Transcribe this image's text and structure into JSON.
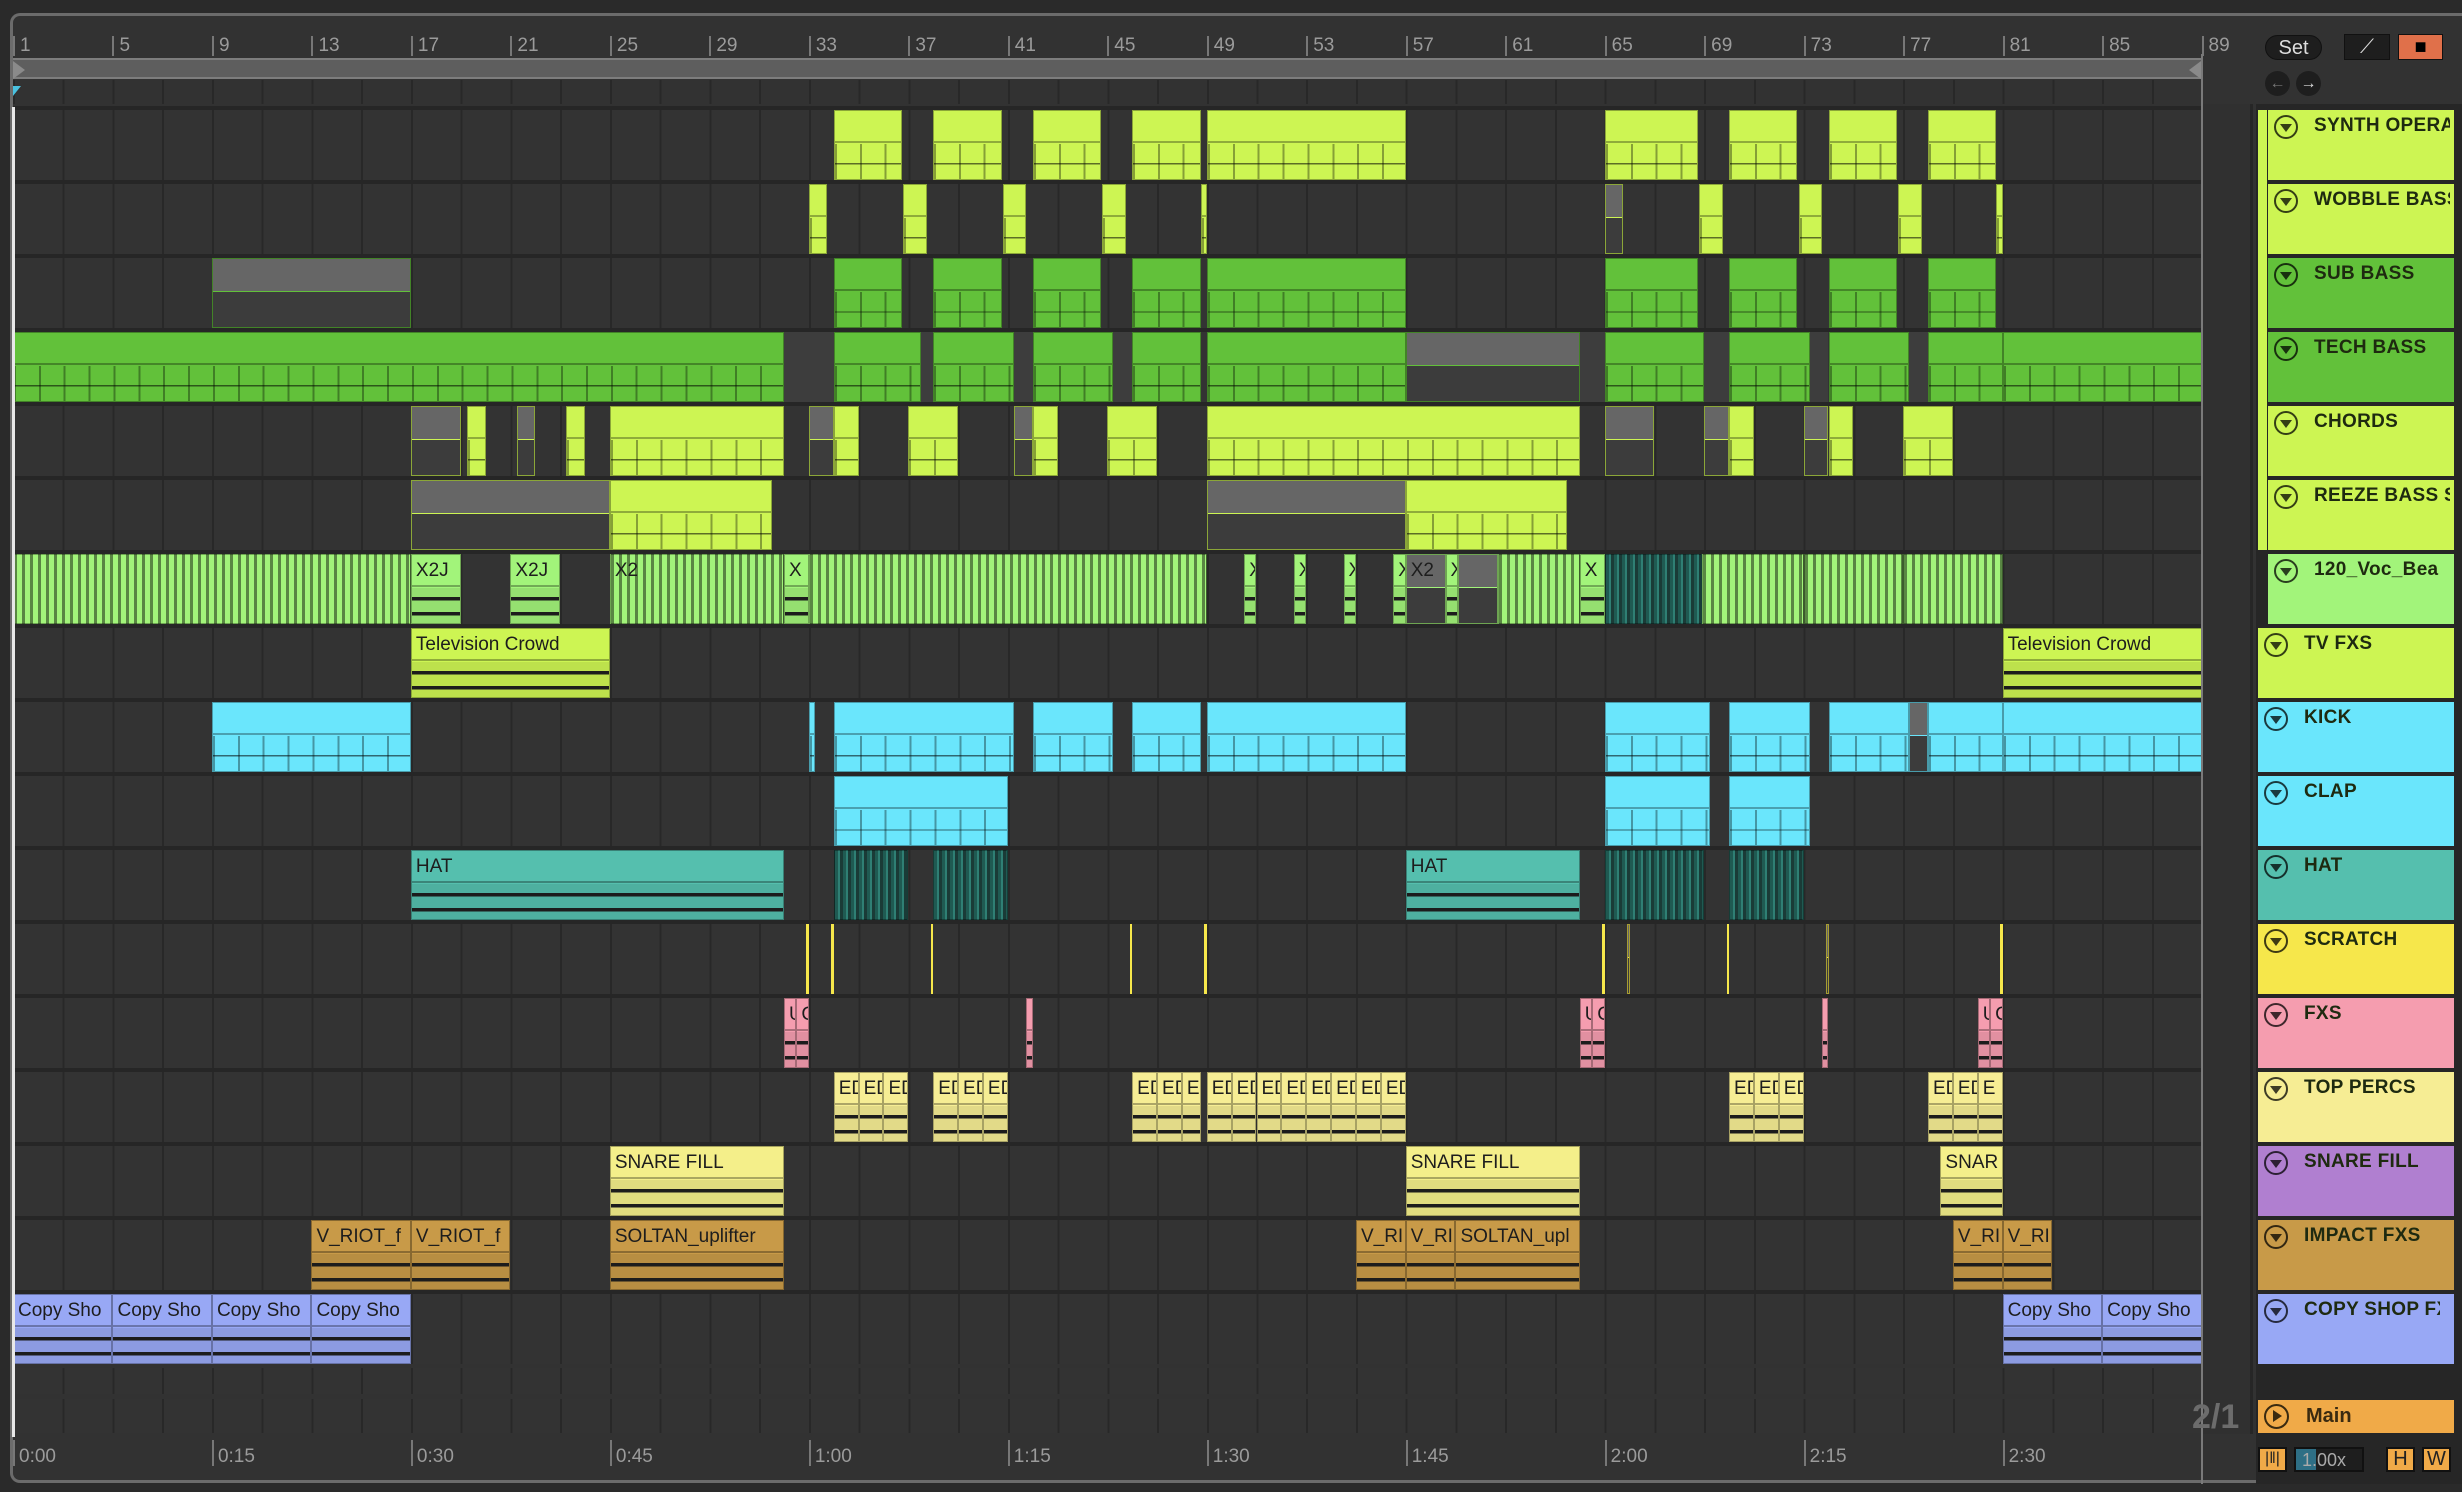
{
  "ruler": {
    "bars": [
      "1",
      "5",
      "9",
      "13",
      "17",
      "21",
      "25",
      "29",
      "33",
      "37",
      "41",
      "45",
      "49",
      "53",
      "57",
      "61",
      "65",
      "69",
      "73",
      "77",
      "81",
      "85",
      "89"
    ],
    "times": [
      "0:00",
      "0:15",
      "0:30",
      "0:45",
      "1:00",
      "1:15",
      "1:30",
      "1:45",
      "2:00",
      "2:15",
      "2:30"
    ]
  },
  "controls": {
    "set_label": "Set",
    "signature": "2/1",
    "zoom_value": "1.00x",
    "h_label": "H",
    "w_label": "W",
    "main_label": "Main",
    "main_color": "#f0aa48",
    "lock_color": "#e0704a"
  },
  "tracks": [
    {
      "name": "SYNTH OPERA",
      "color": "#cdf553",
      "group": true,
      "clips": [
        {
          "s": 34,
          "e": 36.75,
          "k": "midi"
        },
        {
          "s": 38,
          "e": 40.75,
          "k": "midi"
        },
        {
          "s": 42,
          "e": 44.75,
          "k": "midi"
        },
        {
          "s": 46,
          "e": 48.75,
          "k": "midi"
        },
        {
          "s": 49,
          "e": 57,
          "k": "midi"
        },
        {
          "s": 65,
          "e": 68.75,
          "k": "midi"
        },
        {
          "s": 70,
          "e": 72.75,
          "k": "midi"
        },
        {
          "s": 74,
          "e": 76.75,
          "k": "midi"
        },
        {
          "s": 78,
          "e": 80.75,
          "k": "midi"
        }
      ]
    },
    {
      "name": "WOBBLE BASS",
      "color": "#cdf553",
      "group": true,
      "clips": [
        {
          "s": 33,
          "e": 33.75,
          "k": "midi"
        },
        {
          "s": 36.8,
          "e": 37.75,
          "k": "midi"
        },
        {
          "s": 40.8,
          "e": 41.75,
          "k": "midi"
        },
        {
          "s": 44.8,
          "e": 45.75,
          "k": "midi"
        },
        {
          "s": 48.75,
          "e": 49,
          "k": "midi"
        },
        {
          "s": 65,
          "e": 65.75,
          "k": "muted"
        },
        {
          "s": 68.8,
          "e": 69.75,
          "k": "midi"
        },
        {
          "s": 72.8,
          "e": 73.75,
          "k": "midi"
        },
        {
          "s": 76.8,
          "e": 77.75,
          "k": "midi"
        },
        {
          "s": 80.75,
          "e": 81,
          "k": "midi"
        }
      ]
    },
    {
      "name": "SUB BASS",
      "color": "#62c13a",
      "group": true,
      "clips": [
        {
          "s": 9,
          "e": 17,
          "k": "muted"
        },
        {
          "s": 34,
          "e": 36.75,
          "k": "midi"
        },
        {
          "s": 38,
          "e": 40.75,
          "k": "midi"
        },
        {
          "s": 42,
          "e": 44.75,
          "k": "midi"
        },
        {
          "s": 46,
          "e": 48.75,
          "k": "midi"
        },
        {
          "s": 49,
          "e": 57,
          "k": "midi"
        },
        {
          "s": 65,
          "e": 68.75,
          "k": "midi"
        },
        {
          "s": 70,
          "e": 72.75,
          "k": "midi"
        },
        {
          "s": 74,
          "e": 76.75,
          "k": "midi"
        },
        {
          "s": 78,
          "e": 80.75,
          "k": "midi"
        }
      ]
    },
    {
      "name": "TECH BASS",
      "color": "#62c13a",
      "group": true,
      "clips": [
        {
          "s": 1,
          "e": 32,
          "k": "midi"
        },
        {
          "s": 32,
          "e": 34,
          "k": "gap"
        },
        {
          "s": 34,
          "e": 37.5,
          "k": "midi"
        },
        {
          "s": 37.5,
          "e": 38,
          "k": "gap"
        },
        {
          "s": 38,
          "e": 41.25,
          "k": "midi"
        },
        {
          "s": 41.25,
          "e": 42,
          "k": "gap"
        },
        {
          "s": 42,
          "e": 45.25,
          "k": "midi"
        },
        {
          "s": 45.25,
          "e": 46,
          "k": "gap"
        },
        {
          "s": 46,
          "e": 48.75,
          "k": "midi"
        },
        {
          "s": 49,
          "e": 57,
          "k": "midi"
        },
        {
          "s": 57,
          "e": 64,
          "k": "muted"
        },
        {
          "s": 64,
          "e": 65,
          "k": "gap"
        },
        {
          "s": 65,
          "e": 69,
          "k": "midi"
        },
        {
          "s": 69,
          "e": 70,
          "k": "gap"
        },
        {
          "s": 70,
          "e": 73.25,
          "k": "midi"
        },
        {
          "s": 73.25,
          "e": 74,
          "k": "gap"
        },
        {
          "s": 74,
          "e": 77.25,
          "k": "midi"
        },
        {
          "s": 77.25,
          "e": 78,
          "k": "gap"
        },
        {
          "s": 78,
          "e": 81,
          "k": "midi"
        },
        {
          "s": 81,
          "e": 89,
          "k": "midi"
        }
      ]
    },
    {
      "name": "CHORDS",
      "color": "#cdf553",
      "group": true,
      "clips": [
        {
          "s": 17,
          "e": 19,
          "k": "muted"
        },
        {
          "s": 19.25,
          "e": 20,
          "k": "midi"
        },
        {
          "s": 21.25,
          "e": 22,
          "k": "muted"
        },
        {
          "s": 23.25,
          "e": 24,
          "k": "midi"
        },
        {
          "s": 25,
          "e": 32,
          "k": "midi"
        },
        {
          "s": 33,
          "e": 34,
          "k": "muted"
        },
        {
          "s": 34,
          "e": 35,
          "k": "midi"
        },
        {
          "s": 37,
          "e": 39,
          "k": "midi"
        },
        {
          "s": 41.25,
          "e": 42,
          "k": "muted"
        },
        {
          "s": 42,
          "e": 43,
          "k": "midi"
        },
        {
          "s": 45,
          "e": 47,
          "k": "midi"
        },
        {
          "s": 49,
          "e": 64,
          "k": "midi"
        },
        {
          "s": 65,
          "e": 67,
          "k": "muted"
        },
        {
          "s": 69,
          "e": 70,
          "k": "muted"
        },
        {
          "s": 70,
          "e": 71,
          "k": "midi"
        },
        {
          "s": 73,
          "e": 74,
          "k": "muted"
        },
        {
          "s": 74,
          "e": 75,
          "k": "midi"
        },
        {
          "s": 77,
          "e": 79,
          "k": "midi"
        }
      ]
    },
    {
      "name": "REEZE BASS S",
      "color": "#cdf553",
      "group": true,
      "clips": [
        {
          "s": 17,
          "e": 25,
          "k": "muted"
        },
        {
          "s": 25,
          "e": 31.5,
          "k": "midi"
        },
        {
          "s": 49,
          "e": 57,
          "k": "muted"
        },
        {
          "s": 57,
          "e": 63.5,
          "k": "midi"
        }
      ]
    },
    {
      "name": "120_Voc_Bea",
      "color": "#a2f47a",
      "group": true,
      "clips": [
        {
          "s": 1,
          "e": 17,
          "k": "dense"
        },
        {
          "s": 17,
          "e": 19,
          "k": "audio",
          "n": "X2J"
        },
        {
          "s": 21,
          "e": 23,
          "k": "audio",
          "n": "X2J"
        },
        {
          "s": 25,
          "e": 32,
          "k": "dense",
          "n": "X2"
        },
        {
          "s": 32,
          "e": 33,
          "k": "audio",
          "n": "X"
        },
        {
          "s": 33,
          "e": 49,
          "k": "dense"
        },
        {
          "s": 50.5,
          "e": 51,
          "k": "audio",
          "n": "X"
        },
        {
          "s": 52.5,
          "e": 53,
          "k": "audio",
          "n": "X"
        },
        {
          "s": 54.5,
          "e": 55,
          "k": "audio",
          "n": "X"
        },
        {
          "s": 56.5,
          "e": 57,
          "k": "audio",
          "n": "X"
        },
        {
          "s": 57,
          "e": 58.6,
          "k": "muted",
          "n": "X2"
        },
        {
          "s": 58.6,
          "e": 59.1,
          "k": "audio",
          "n": "X"
        },
        {
          "s": 59.1,
          "e": 60.7,
          "k": "muted"
        },
        {
          "s": 60.7,
          "e": 64,
          "k": "dense"
        },
        {
          "s": 64,
          "e": 65,
          "k": "audio",
          "n": "X"
        },
        {
          "s": 65,
          "e": 68.9,
          "k": "darkdense"
        },
        {
          "s": 68.9,
          "e": 73,
          "k": "dense"
        },
        {
          "s": 73,
          "e": 77,
          "k": "dense"
        },
        {
          "s": 77,
          "e": 81,
          "k": "dense"
        }
      ]
    },
    {
      "name": "TV FXS",
      "color": "#cdf553",
      "group": false,
      "clips": [
        {
          "s": 17,
          "e": 25,
          "k": "audio",
          "n": "Television Crowd"
        },
        {
          "s": 81,
          "e": 89,
          "k": "audio",
          "n": "Television Crowd"
        }
      ]
    },
    {
      "name": "KICK",
      "color": "#6ae6fc",
      "group": false,
      "clips": [
        {
          "s": 9,
          "e": 17,
          "k": "midi"
        },
        {
          "s": 33,
          "e": 33.25,
          "k": "midi"
        },
        {
          "s": 34,
          "e": 41.25,
          "k": "midi"
        },
        {
          "s": 42,
          "e": 45.25,
          "k": "midi"
        },
        {
          "s": 46,
          "e": 48.75,
          "k": "midi"
        },
        {
          "s": 49,
          "e": 57,
          "k": "midi"
        },
        {
          "s": 65,
          "e": 69.25,
          "k": "midi"
        },
        {
          "s": 70,
          "e": 73.25,
          "k": "midi"
        },
        {
          "s": 74,
          "e": 77.25,
          "k": "midi"
        },
        {
          "s": 77.25,
          "e": 78,
          "k": "muted"
        },
        {
          "s": 78,
          "e": 81,
          "k": "midi"
        },
        {
          "s": 81,
          "e": 89,
          "k": "midi"
        }
      ]
    },
    {
      "name": "CLAP",
      "color": "#6ae6fc",
      "group": false,
      "clips": [
        {
          "s": 34,
          "e": 41,
          "k": "midi"
        },
        {
          "s": 65,
          "e": 69.25,
          "k": "midi"
        },
        {
          "s": 70,
          "e": 73.25,
          "k": "midi"
        }
      ]
    },
    {
      "name": "HAT",
      "color": "#55bfae",
      "group": false,
      "clips": [
        {
          "s": 17,
          "e": 32,
          "k": "audio",
          "n": "HAT"
        },
        {
          "s": 34,
          "e": 37,
          "k": "darkdense"
        },
        {
          "s": 38,
          "e": 41,
          "k": "darkdense"
        },
        {
          "s": 57,
          "e": 64,
          "k": "audio",
          "n": "HAT"
        },
        {
          "s": 65,
          "e": 69,
          "k": "darkdense"
        },
        {
          "s": 70,
          "e": 73,
          "k": "darkdense"
        }
      ]
    },
    {
      "name": "SCRATCH",
      "color": "#f6e74b",
      "group": false,
      "clips": [
        {
          "s": 32.9,
          "e": 33,
          "k": "thin"
        },
        {
          "s": 33.9,
          "e": 34,
          "k": "thin"
        },
        {
          "s": 37.9,
          "e": 38,
          "k": "thin"
        },
        {
          "s": 45.9,
          "e": 46,
          "k": "thin"
        },
        {
          "s": 48.9,
          "e": 49,
          "k": "thin"
        },
        {
          "s": 64.9,
          "e": 65,
          "k": "thin"
        },
        {
          "s": 65.9,
          "e": 66,
          "k": "muted"
        },
        {
          "s": 69.9,
          "e": 70,
          "k": "thin"
        },
        {
          "s": 73.9,
          "e": 74,
          "k": "muted"
        },
        {
          "s": 80.9,
          "e": 81,
          "k": "thin"
        }
      ]
    },
    {
      "name": "FXS",
      "color": "#f59daf",
      "group": false,
      "clips": [
        {
          "s": 32,
          "e": 32.5,
          "k": "audio",
          "n": "U"
        },
        {
          "s": 32.5,
          "e": 33,
          "k": "audio",
          "n": "C"
        },
        {
          "s": 41.75,
          "e": 42,
          "k": "audio"
        },
        {
          "s": 64,
          "e": 64.5,
          "k": "audio",
          "n": "U"
        },
        {
          "s": 64.5,
          "e": 65,
          "k": "audio",
          "n": "C"
        },
        {
          "s": 73.75,
          "e": 74,
          "k": "audio"
        },
        {
          "s": 80,
          "e": 80.5,
          "k": "audio",
          "n": "U"
        },
        {
          "s": 80.5,
          "e": 81,
          "k": "audio",
          "n": "C"
        }
      ]
    },
    {
      "name": "TOP PERCS",
      "color": "#f6ed94",
      "group": false,
      "clips": [
        {
          "s": 34,
          "e": 35,
          "k": "audio",
          "n": "ED"
        },
        {
          "s": 35,
          "e": 36,
          "k": "audio",
          "n": "ED"
        },
        {
          "s": 36,
          "e": 37,
          "k": "audio",
          "n": "ED"
        },
        {
          "s": 38,
          "e": 39,
          "k": "audio",
          "n": "ED"
        },
        {
          "s": 39,
          "e": 40,
          "k": "audio",
          "n": "ED"
        },
        {
          "s": 40,
          "e": 41,
          "k": "audio",
          "n": "ED"
        },
        {
          "s": 46,
          "e": 47,
          "k": "audio",
          "n": "ED"
        },
        {
          "s": 47,
          "e": 48,
          "k": "audio",
          "n": "ED"
        },
        {
          "s": 48,
          "e": 48.75,
          "k": "audio",
          "n": "ED"
        },
        {
          "s": 49,
          "e": 50,
          "k": "audio",
          "n": "ED"
        },
        {
          "s": 50,
          "e": 51,
          "k": "audio",
          "n": "ED"
        },
        {
          "s": 51,
          "e": 52,
          "k": "audio",
          "n": "ED"
        },
        {
          "s": 52,
          "e": 53,
          "k": "audio",
          "n": "ED"
        },
        {
          "s": 53,
          "e": 54,
          "k": "audio",
          "n": "ED"
        },
        {
          "s": 54,
          "e": 55,
          "k": "audio",
          "n": "ED"
        },
        {
          "s": 55,
          "e": 56,
          "k": "audio",
          "n": "ED"
        },
        {
          "s": 56,
          "e": 57,
          "k": "audio",
          "n": "ED"
        },
        {
          "s": 70,
          "e": 71,
          "k": "audio",
          "n": "ED"
        },
        {
          "s": 71,
          "e": 72,
          "k": "audio",
          "n": "ED"
        },
        {
          "s": 72,
          "e": 73,
          "k": "audio",
          "n": "ED"
        },
        {
          "s": 78,
          "e": 79,
          "k": "audio",
          "n": "ED"
        },
        {
          "s": 79,
          "e": 80,
          "k": "audio",
          "n": "ED"
        },
        {
          "s": 80,
          "e": 81,
          "k": "audio",
          "n": "E"
        }
      ]
    },
    {
      "name": "SNARE FILL",
      "color": "#b07fd0",
      "clipcolor": "#f4ef8a",
      "group": false,
      "clips": [
        {
          "s": 25,
          "e": 32,
          "k": "audio",
          "n": "SNARE FILL"
        },
        {
          "s": 57,
          "e": 64,
          "k": "audio",
          "n": "SNARE FILL"
        },
        {
          "s": 78.5,
          "e": 81,
          "k": "audio",
          "n": "SNAR"
        }
      ]
    },
    {
      "name": "IMPACT FXS",
      "color": "#c89a48",
      "group": false,
      "clips": [
        {
          "s": 13,
          "e": 17,
          "k": "audio",
          "n": "V_RIOT_f"
        },
        {
          "s": 17,
          "e": 21,
          "k": "audio",
          "n": "V_RIOT_f"
        },
        {
          "s": 25,
          "e": 32,
          "k": "audio",
          "n": "SOLTAN_uplifter"
        },
        {
          "s": 55,
          "e": 57,
          "k": "audio",
          "n": "V_RI"
        },
        {
          "s": 57,
          "e": 59,
          "k": "audio",
          "n": "V_RI"
        },
        {
          "s": 59,
          "e": 64,
          "k": "audio",
          "n": "SOLTAN_upl"
        },
        {
          "s": 79,
          "e": 81,
          "k": "audio",
          "n": "V_RI"
        },
        {
          "s": 81,
          "e": 83,
          "k": "audio",
          "n": "V_RI"
        }
      ]
    },
    {
      "name": "COPY SHOP FX",
      "color": "#98a8f5",
      "group": false,
      "clips": [
        {
          "s": 1,
          "e": 5,
          "k": "audio",
          "n": "Copy Sho"
        },
        {
          "s": 5,
          "e": 9,
          "k": "audio",
          "n": "Copy Sho"
        },
        {
          "s": 9,
          "e": 13,
          "k": "audio",
          "n": "Copy Sho"
        },
        {
          "s": 13,
          "e": 17,
          "k": "audio",
          "n": "Copy Sho"
        },
        {
          "s": 81,
          "e": 85,
          "k": "audio",
          "n": "Copy Sho"
        },
        {
          "s": 85,
          "e": 89,
          "k": "audio",
          "n": "Copy Sho"
        }
      ]
    }
  ]
}
